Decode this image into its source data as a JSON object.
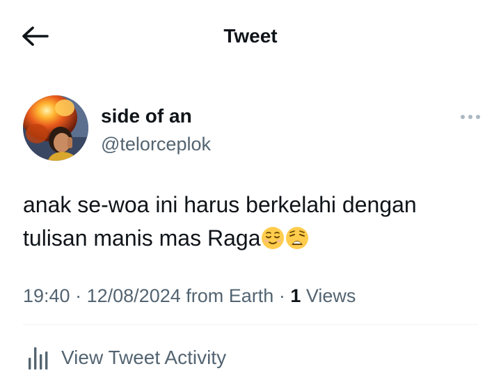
{
  "header": {
    "title": "Tweet",
    "back_icon": "arrow-left-icon"
  },
  "tweet": {
    "author": {
      "display_name": "side of an",
      "handle": "@telorceplok"
    },
    "more_icon": "more-horizontal-icon",
    "text": "anak se-woa ini harus berkelahi dengan tulisan manis mas Raga",
    "emojis": [
      "relieved-face-emoji",
      "weary-face-emoji"
    ],
    "meta": {
      "time": "19:40",
      "separator": "·",
      "date": "12/08/2024",
      "source": "from Earth",
      "views_count": "1",
      "views_label": "Views"
    },
    "activity": {
      "icon": "bar-chart-icon",
      "label": "View Tweet Activity"
    }
  },
  "colors": {
    "primary_text": "#0f1419",
    "secondary_text": "#536471",
    "divider": "#eff3f4",
    "background": "#ffffff"
  }
}
